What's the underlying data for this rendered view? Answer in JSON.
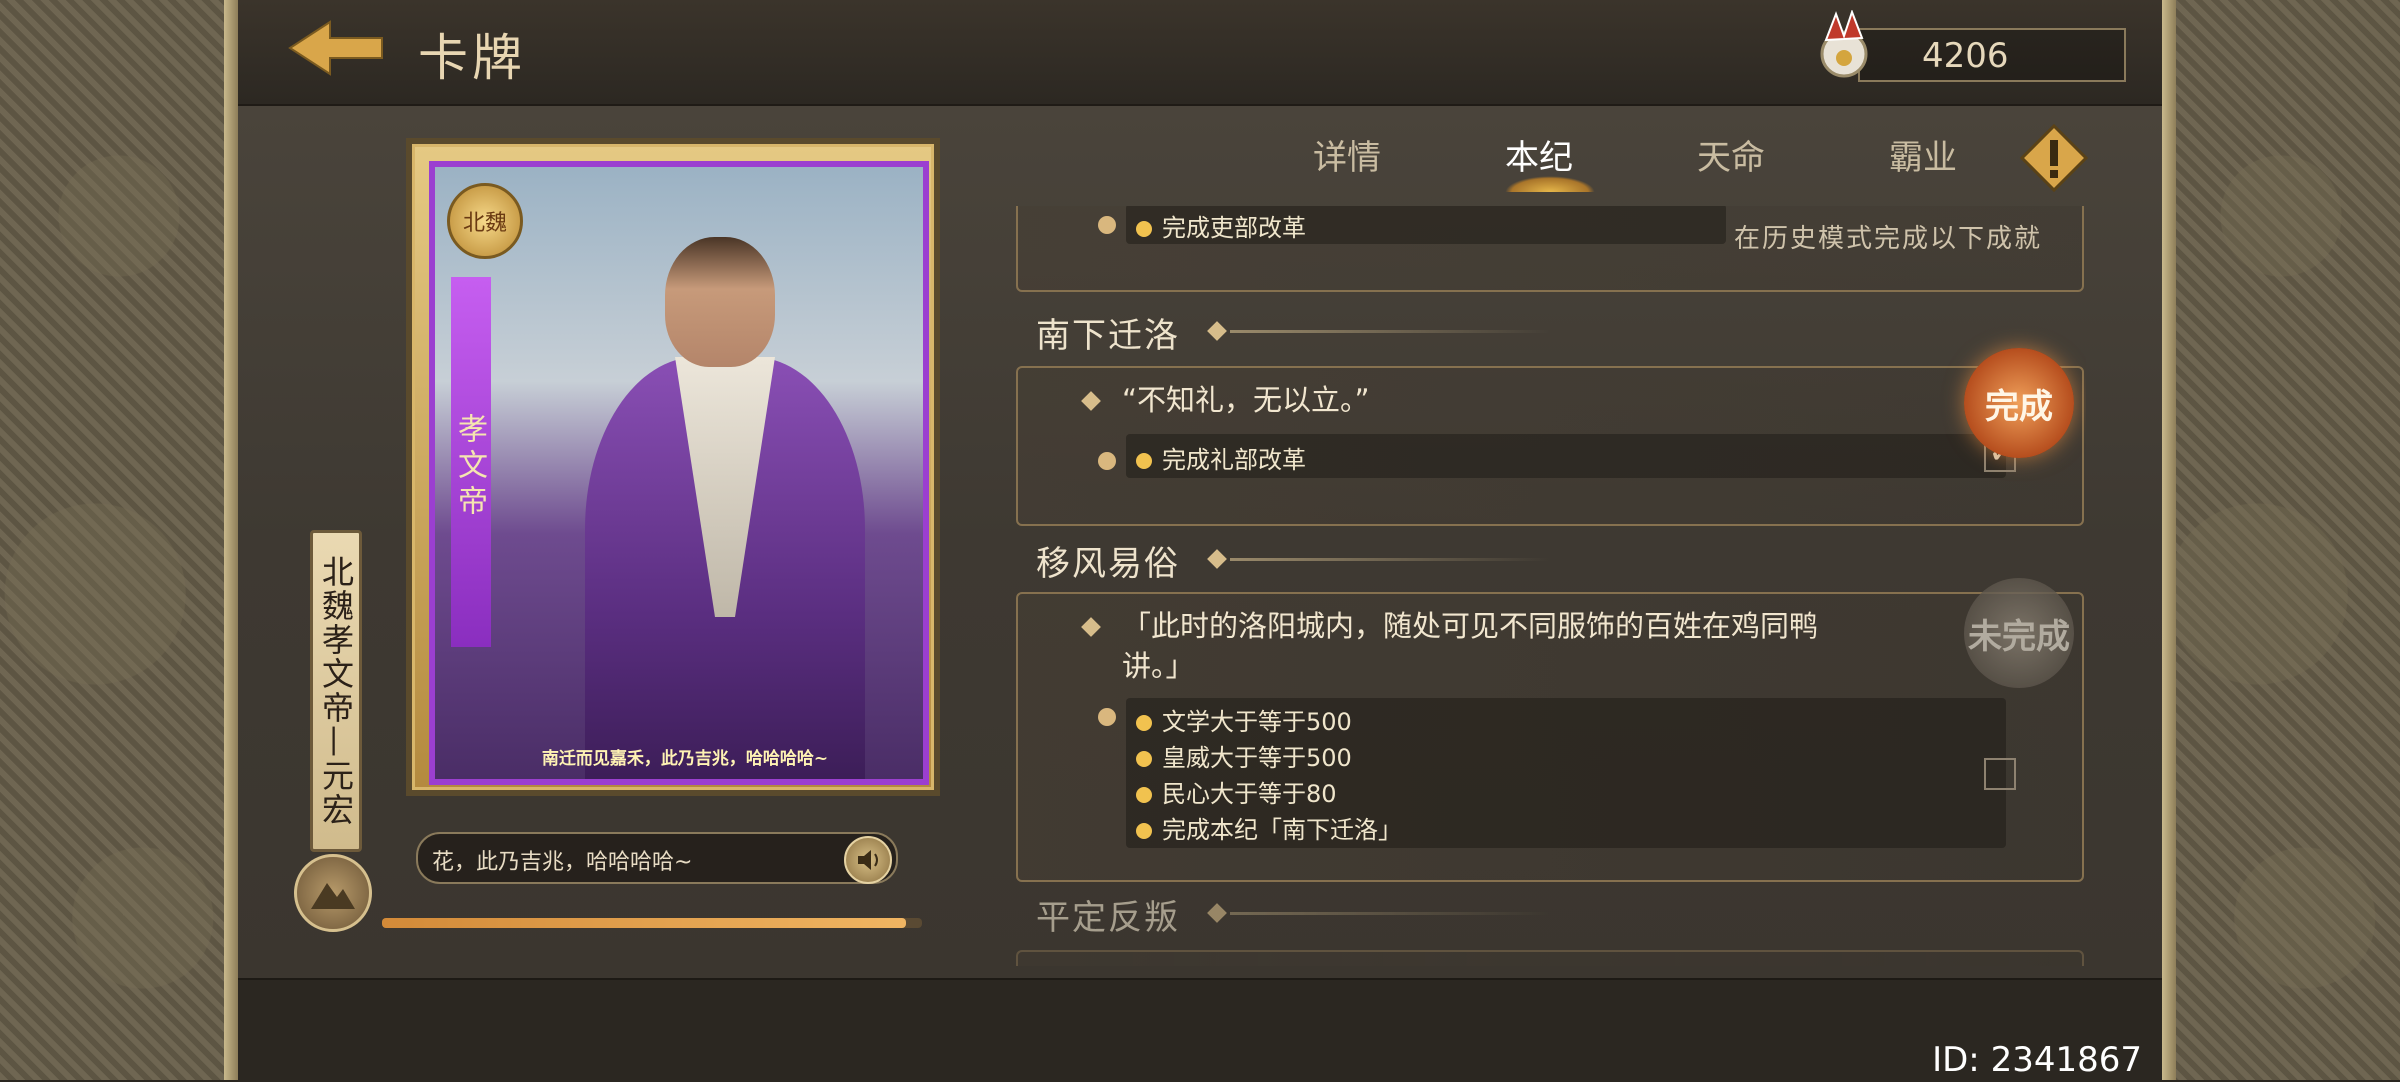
{
  "header": {
    "title": "卡牌",
    "currency_value": "4206"
  },
  "card": {
    "name_vertical": "北魏孝文帝—元宏",
    "voice_line": "花，此乃吉兆，哈哈哈哈~",
    "card_quote": "南迁而见嘉禾，此乃吉兆，哈哈哈哈~",
    "card_name_overlay": "孝文帝",
    "card_badge": "北魏",
    "voice_progress": 0.97
  },
  "tabs": [
    {
      "label": "详情"
    },
    {
      "label": "本纪"
    },
    {
      "label": "天命"
    },
    {
      "label": "霸业"
    }
  ],
  "active_tab": "本纪",
  "sections": {
    "top_partial": {
      "condition": "完成吏部改革",
      "hint": "在历史模式完成以下成就"
    },
    "s1": {
      "title": "南下迁洛",
      "quote": "“不知礼，无以立。”",
      "conditions": [
        "完成礼部改革"
      ],
      "status": "完成",
      "checked": true
    },
    "s2": {
      "title": "移风易俗",
      "quote_line1": "「此时的洛阳城内，随处可见不同服饰的百姓在鸡同鸭",
      "quote_line2": "讲。」",
      "conditions": [
        "文学大于等于500",
        "皇威大于等于500",
        "民心大于等于80",
        "完成本纪「南下迁洛」"
      ],
      "status": "未完成",
      "checked": false
    },
    "s3": {
      "title": "平定反叛"
    }
  },
  "footer": {
    "id_text": "ID: 2341867"
  },
  "colors": {
    "accent_gold": "#d9b77e",
    "done_stamp": "#b64e1e",
    "card_purple": "#9b3fd0"
  }
}
